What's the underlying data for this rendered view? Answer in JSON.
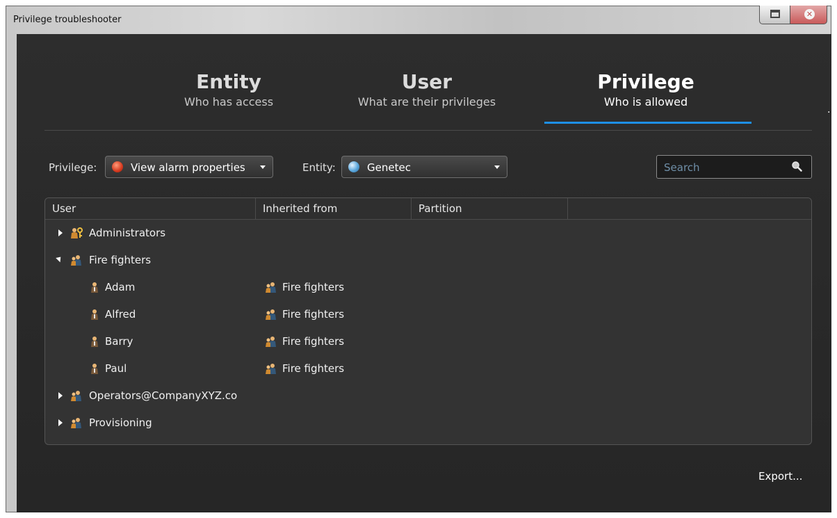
{
  "window": {
    "title": "Privilege troubleshooter"
  },
  "tabs": [
    {
      "title": "Entity",
      "subtitle": "Who has access",
      "active": false
    },
    {
      "title": "User",
      "subtitle": "What are their privileges",
      "active": false
    },
    {
      "title": "Privilege",
      "subtitle": "Who is allowed",
      "active": true
    }
  ],
  "filters": {
    "privilege_label": "Privilege:",
    "privilege_value": "View alarm properties",
    "entity_label": "Entity:",
    "entity_value": "Genetec",
    "search_placeholder": "Search"
  },
  "grid": {
    "columns": [
      "User",
      "Inherited from",
      "Partition"
    ],
    "rows": [
      {
        "name": "Administrators",
        "icon": "admin-group-icon",
        "expander": "collapsed",
        "inherited": ""
      },
      {
        "name": "Fire fighters",
        "icon": "user-group-icon",
        "expander": "expanded",
        "inherited": ""
      },
      {
        "name": "Adam",
        "icon": "user-icon",
        "expander": "none",
        "inherited": "Fire fighters"
      },
      {
        "name": "Alfred",
        "icon": "user-icon",
        "expander": "none",
        "inherited": "Fire fighters"
      },
      {
        "name": "Barry",
        "icon": "user-icon",
        "expander": "none",
        "inherited": "Fire fighters"
      },
      {
        "name": "Paul",
        "icon": "user-icon",
        "expander": "none",
        "inherited": "Fire fighters"
      },
      {
        "name": "Operators@CompanyXYZ.co",
        "icon": "user-group-icon",
        "expander": "collapsed",
        "inherited": ""
      },
      {
        "name": "Provisioning",
        "icon": "user-group-icon",
        "expander": "collapsed",
        "inherited": ""
      }
    ]
  },
  "footer": {
    "export_label": "Export..."
  },
  "colors": {
    "accent": "#1e8fe6",
    "background": "#2b2b2b"
  }
}
